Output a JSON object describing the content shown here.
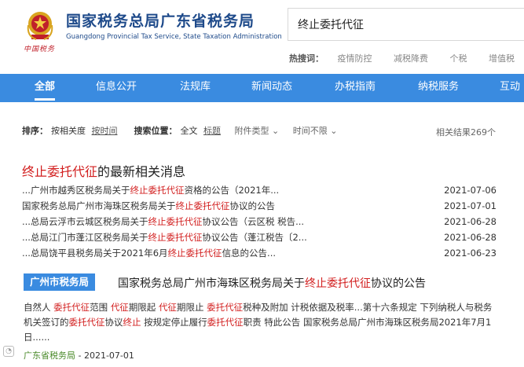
{
  "header": {
    "title": "国家税务总局广东省税务局",
    "subtitle": "Guangdong Provincial Tax Service, State Taxation Administration",
    "slogan": "中国税务",
    "emblem_icon": "tax-emblem-icon"
  },
  "search": {
    "value": "终止委托代征"
  },
  "hot": {
    "label": "热搜词：",
    "items": [
      "疫情防控",
      "减税降费",
      "个税",
      "增值税"
    ]
  },
  "nav": {
    "items": [
      "全部",
      "信息公开",
      "法规库",
      "新闻动态",
      "办税指南",
      "纳税服务",
      "互动"
    ]
  },
  "sortbar": {
    "sort_label": "排序：",
    "sort_relevance": "按相关度",
    "sort_time": "按时间",
    "scope_label": "搜索位置：",
    "scope_all": "全文",
    "scope_title": "标题",
    "attach_type": "附件类型",
    "time_limit": "时间不限",
    "result_count": "相关结果269个"
  },
  "latest": {
    "title_hl": "终止委托代征",
    "title_rest": "的最新相关消息",
    "rows": [
      {
        "pre": "...广州市越秀区税务局关于",
        "hl": "终止委托代征",
        "post": "资格的公告（2021年...",
        "date": "2021-07-06"
      },
      {
        "pre": "国家税务总局广州市海珠区税务局关于",
        "hl": "终止委托代征",
        "post": "协议的公告",
        "date": "2021-07-01"
      },
      {
        "pre": "...总局云浮市云城区税务局关于",
        "hl": "终止委托代征",
        "post": "协议公告（云区税 税告...",
        "date": "2021-06-28"
      },
      {
        "pre": "...总局江门市蓬江区税务局关于",
        "hl": "终止委托代征",
        "post": "协议公告（蓬江税告〔2...",
        "date": "2021-06-28"
      },
      {
        "pre": "...总局饶平县税务局关于2021年6月",
        "hl": "终止委托代征",
        "post": "信息的公告...",
        "date": "2021-06-23"
      }
    ]
  },
  "result": {
    "tag": "广州市税务局",
    "title_pre": "国家税务总局广州市海珠区税务局关于",
    "title_hl": "终止委托代征",
    "title_post": "协议的公告",
    "body": [
      {
        "t": "自然人 ",
        "h": false
      },
      {
        "t": "委托代征",
        "h": true
      },
      {
        "t": "范围 ",
        "h": false
      },
      {
        "t": "代征",
        "h": true
      },
      {
        "t": "期限起 ",
        "h": false
      },
      {
        "t": "代征",
        "h": true
      },
      {
        "t": "期限止 ",
        "h": false
      },
      {
        "t": "委托代征",
        "h": true
      },
      {
        "t": "税种及附加 计税依据及税率...第十六条规定 下列纳税人与税务机关签订的",
        "h": false
      },
      {
        "t": "委托代征",
        "h": true
      },
      {
        "t": "协议",
        "h": false
      },
      {
        "t": "终止",
        "h": true
      },
      {
        "t": " 按规定停止履行",
        "h": false
      },
      {
        "t": "委托代征",
        "h": true
      },
      {
        "t": "职责 特此公告 国家税务总局广州市海珠区税务局2021年7月1日......",
        "h": false
      }
    ],
    "source": "广东省税务局",
    "date": " - 2021-07-01"
  },
  "colors": {
    "brand_blue": "#1e4a8a",
    "nav_blue": "#3a8be0",
    "highlight_red": "#d21e1e"
  }
}
